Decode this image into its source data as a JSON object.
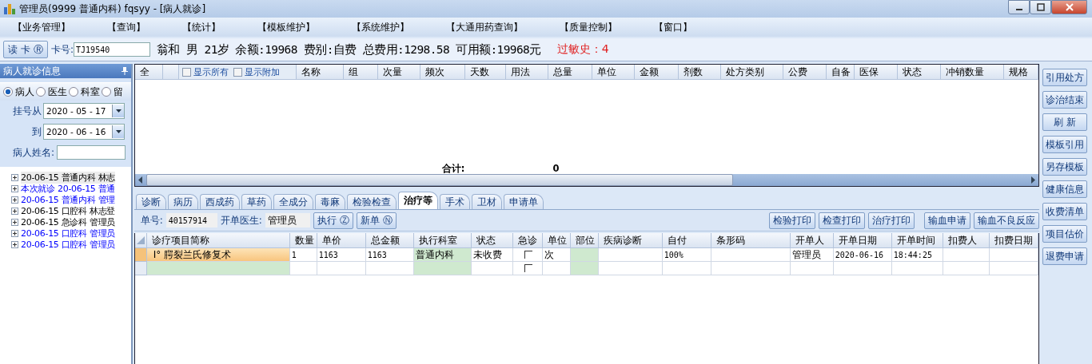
{
  "window": {
    "title": "管理员(9999 普通内科) fqsyy - [病人就诊]"
  },
  "menu": [
    "【业务管理】",
    "【查询】",
    "【统计】",
    "【模板维护】",
    "【系统维护】",
    "【大通用药查询】",
    "【质量控制】",
    "【窗口】"
  ],
  "patient_bar": {
    "read_button": "读 卡 Ⓡ",
    "card_label": "卡号:",
    "card_value": "TJ19540",
    "info": "翁和 男 21岁 余额:19968 费别:自费 总费用:1298.58 可用额:19968元",
    "allergy": "过敏史：4"
  },
  "left_panel": {
    "title": "病人就诊信息",
    "radios": [
      {
        "label": "病人",
        "selected": true
      },
      {
        "label": "医生",
        "selected": false
      },
      {
        "label": "科室",
        "selected": false
      },
      {
        "label": "留",
        "selected": false
      }
    ],
    "from_label": "挂号从",
    "from_date": "2020 - 05 - 17",
    "to_label": "到",
    "to_date": "2020 - 06 - 16",
    "name_label": "病人姓名:",
    "visits": [
      {
        "text": "20-06-15 普通内科 林志",
        "color": "#000000",
        "selected": true
      },
      {
        "text": "本次就诊 20-06-15 普通",
        "color": "#0000ff",
        "selected": false
      },
      {
        "text": "20-06-15 普通内科 管理",
        "color": "#0000ff",
        "selected": false
      },
      {
        "text": "20-06-15 口腔科 林志登",
        "color": "#000000",
        "selected": false
      },
      {
        "text": "20-06-15 急诊科 管理员",
        "color": "#000000",
        "selected": false
      },
      {
        "text": "20-06-15 口腔科 管理员",
        "color": "#0000ff",
        "selected": false
      },
      {
        "text": "20-06-15 口腔科 管理员",
        "color": "#0000ff",
        "selected": false
      }
    ]
  },
  "prescription": {
    "select_all": "全",
    "options": [
      {
        "label": "显示所有",
        "checked": false
      },
      {
        "label": "显示附加",
        "checked": false
      }
    ],
    "columns": [
      "名称",
      "组",
      "次量",
      "频次",
      "天数",
      "用法",
      "总量",
      "单位",
      "金额",
      "剂数",
      "处方类别",
      "公费",
      "自备",
      "医保",
      "状态",
      "冲销数量",
      "规格"
    ],
    "total_label": "合计:",
    "total_value": "0"
  },
  "tabs": [
    {
      "label": "诊断",
      "selected": false
    },
    {
      "label": "病历",
      "selected": false
    },
    {
      "label": "西成药",
      "selected": false
    },
    {
      "label": "草药",
      "selected": false
    },
    {
      "label": "全成分",
      "selected": false
    },
    {
      "label": "毒麻",
      "selected": false
    },
    {
      "label": "检验检查",
      "selected": false
    },
    {
      "label": "治疗等",
      "selected": true
    },
    {
      "label": "手术",
      "selected": false
    },
    {
      "label": "卫材",
      "selected": false
    },
    {
      "label": "申请单",
      "selected": false
    }
  ],
  "order_toolbar": {
    "order_label": "单号:",
    "order_no": "40157914",
    "doctor_label": "开单医生:",
    "doctor": "管理员",
    "buttons": [
      "执行 Ⓩ",
      "新单 Ⓝ"
    ],
    "print_buttons": [
      "检验打印",
      "检查打印",
      "治疗打印"
    ],
    "request_buttons": [
      "输血申请",
      "输血不良反应"
    ]
  },
  "treatment": {
    "columns": [
      "诊疗项目简称",
      "数量",
      "单价",
      "总金额",
      "执行科室",
      "状态",
      "急诊",
      "单位",
      "部位",
      "疾病诊断",
      "自付",
      "条形码",
      "开单人",
      "开单日期",
      "开单时间",
      "扣费人",
      "扣费日期"
    ],
    "rows": [
      {
        "selected": true,
        "urgent": false,
        "cells": [
          "Ⅰ° 腭裂兰氏修复术",
          "1",
          "1163",
          "1163",
          "普通内科",
          "未收费",
          "",
          "次",
          "",
          "",
          "100%",
          "",
          "管理员",
          "2020-06-16",
          "18:44:25",
          "",
          ""
        ]
      },
      {
        "selected": false,
        "urgent": false,
        "cells": [
          "",
          "",
          "",
          "",
          "",
          "",
          "",
          "",
          "",
          "",
          "",
          "",
          "",
          "",
          "",
          "",
          ""
        ]
      }
    ]
  },
  "side_buttons": [
    "引用处方",
    "诊治结束",
    "刷  新",
    "模板引用",
    "另存模板",
    "健康信息",
    "收费清单",
    "项目估价",
    "退费申请"
  ]
}
